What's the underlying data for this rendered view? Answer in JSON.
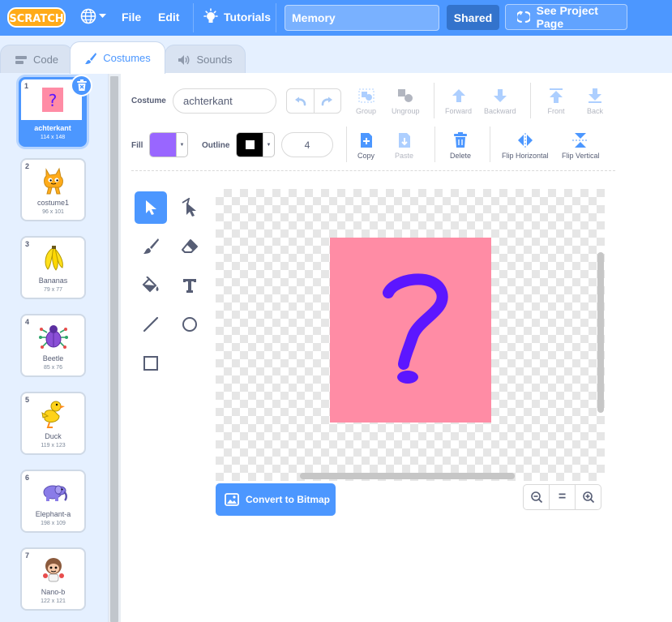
{
  "menubar": {
    "logo_text": "SCRATCH",
    "file_label": "File",
    "edit_label": "Edit",
    "tutorials_label": "Tutorials",
    "project_title": "Memory",
    "shared_label": "Shared",
    "see_project_label": "See Project Page"
  },
  "tabs": {
    "code_label": "Code",
    "costumes_label": "Costumes",
    "sounds_label": "Sounds",
    "active": "Costumes"
  },
  "costumes": [
    {
      "number": "1",
      "name": "achterkant",
      "size": "114 x 148",
      "thumb": "question-mark-card",
      "selected": true
    },
    {
      "number": "2",
      "name": "costume1",
      "size": "96 x 101",
      "thumb": "cat"
    },
    {
      "number": "3",
      "name": "Bananas",
      "size": "79 x 77",
      "thumb": "bananas"
    },
    {
      "number": "4",
      "name": "Beetle",
      "size": "85 x 76",
      "thumb": "beetle"
    },
    {
      "number": "5",
      "name": "Duck",
      "size": "119 x 123",
      "thumb": "duck"
    },
    {
      "number": "6",
      "name": "Elephant-a",
      "size": "198 x 109",
      "thumb": "elephant"
    },
    {
      "number": "7",
      "name": "Nano-b",
      "size": "122 x 121",
      "thumb": "nano"
    }
  ],
  "editor": {
    "costume_label": "Costume",
    "costume_name": "achterkant",
    "fill_label": "Fill",
    "fill_color": "#9966ff",
    "outline_label": "Outline",
    "outline_color": "#000000",
    "stroke_width": "4",
    "toolbar": {
      "group": "Group",
      "ungroup": "Ungroup",
      "forward": "Forward",
      "backward": "Backward",
      "front": "Front",
      "back": "Back",
      "copy": "Copy",
      "paste": "Paste",
      "delete": "Delete",
      "flip_horizontal": "Flip Horizontal",
      "flip_vertical": "Flip Vertical"
    },
    "tools": [
      "select",
      "reshape",
      "brush",
      "eraser",
      "fill",
      "text",
      "line",
      "circle",
      "rectangle"
    ],
    "active_tool": "select",
    "canvas_art_glyph": "?",
    "canvas_art_bg": "#ff8ca5",
    "canvas_art_fg": "#5c16ff",
    "convert_label": "Convert to Bitmap",
    "zoom_reset_glyph": "="
  },
  "colors": {
    "accent": "#4c97ff",
    "menubar": "#4c97ff",
    "shared_btn": "#3373cc",
    "panel_bg": "#e5f0ff"
  }
}
